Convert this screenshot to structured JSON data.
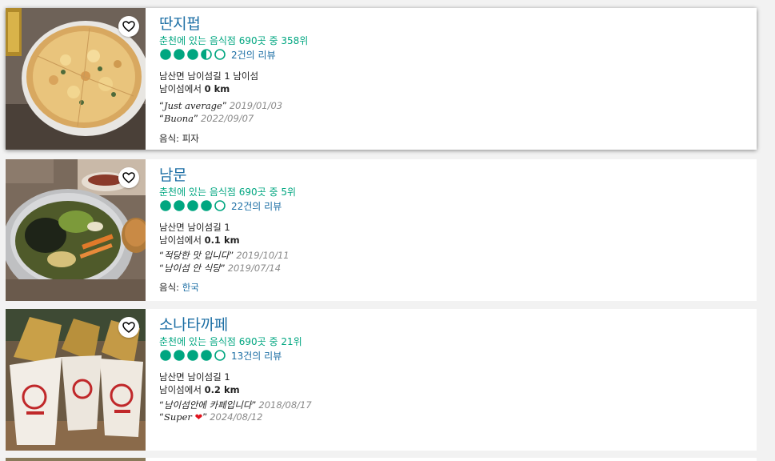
{
  "restaurants": [
    {
      "name": "딴지펍",
      "rank": "춘천에 있는 음식점 690곳 중 358위",
      "rating": 3.5,
      "review_count": "2건의 리뷰",
      "address": "남산면 남이섬길 1 남이섬",
      "distance_prefix": "남이섬에서",
      "distance": "0 km",
      "reviews": [
        {
          "title": "Just average",
          "date": "2019/01/03"
        },
        {
          "title": "Buona",
          "date": "2022/09/07"
        }
      ],
      "cuisine_label": "음식:",
      "cuisine": "피자",
      "photo_subject": "pizza"
    },
    {
      "name": "남문",
      "rank": "춘천에 있는 음식점 690곳 중 5위",
      "rating": 4,
      "review_count": "22건의 리뷰",
      "address": "남산면 남이섬길 1",
      "distance_prefix": "남이섬에서",
      "distance": "0.1 km",
      "reviews": [
        {
          "title": "적당한 맛 입니다",
          "date": "2019/10/11"
        },
        {
          "title": "남이섬 안 식당",
          "date": "2019/07/14"
        }
      ],
      "cuisine_label": "음식:",
      "cuisine": "한국",
      "photo_subject": "bibimbap"
    },
    {
      "name": "소나타까페",
      "rank": "춘천에 있는 음식점 690곳 중 21위",
      "rating": 4,
      "review_count": "13건의 리뷰",
      "address": "남산면 남이섬길 1",
      "distance_prefix": "남이섬에서",
      "distance": "0.2 km",
      "reviews": [
        {
          "title": "남이섬안에 카페입니다",
          "date": "2018/08/17"
        },
        {
          "title": "Super ❤",
          "date": "2024/08/12"
        }
      ],
      "photo_subject": "pancake-cups"
    }
  ],
  "colors": {
    "brand_green": "#00a680",
    "link_blue": "#1d6fa5",
    "date_gray": "#8a8a8a",
    "heart_red": "#e0141e"
  },
  "icons": {
    "save": "heart-outline-icon",
    "rating": "rating-bubble-icon"
  }
}
